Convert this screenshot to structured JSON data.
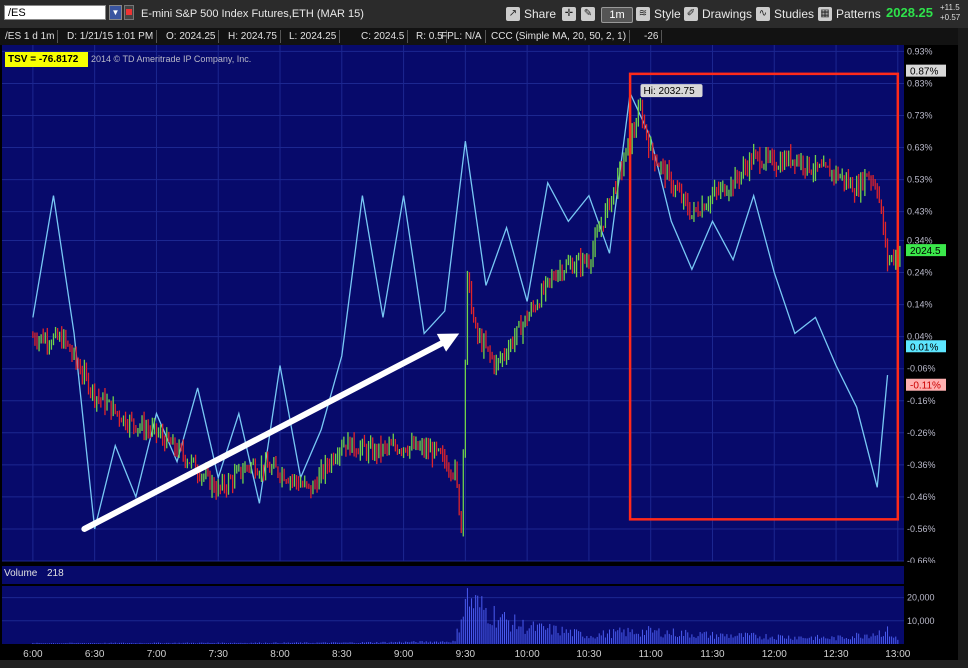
{
  "toolbar": {
    "symbol": "/ES",
    "instrument_title": "E-mini S&P 500 Index Futures,ETH (MAR 15)",
    "share_label": "Share",
    "timeframe_label": "1m",
    "style_label": "Style",
    "drawings_label": "Drawings",
    "studies_label": "Studies",
    "patterns_label": "Patterns",
    "last_price": "2028.25",
    "change_abs": "+11.5",
    "change_pct": "+0.57"
  },
  "info": {
    "chart_label": "/ES 1 d 1m",
    "date": "D: 1/21/15 1:01 PM",
    "open": "O: 2024.25",
    "high": "H: 2024.75",
    "low": "L: 2024.25",
    "close": "C: 2024.5",
    "range": "R: 0.5",
    "fpl": "FPL: N/A",
    "study": "CCC (Simple MA, 20, 50, 2, 1)",
    "study_value": "-26"
  },
  "tsv": {
    "label": "TSV  = -76.8172",
    "copyright": "2014 © TD Ameritrade IP Company, Inc."
  },
  "volume": {
    "label": "Volume",
    "value": "218"
  },
  "colors": {
    "chart_bg": "#070a6b",
    "up_bar": "#6fd24a",
    "down_bar": "#e0242a",
    "oscillator": "#78c8f5",
    "box": "#ff2a1a",
    "arrow": "#ffffff",
    "grid": "#1c2790"
  },
  "chart_data": {
    "type": "line",
    "price_axis_ticks": [
      "0.93%",
      "0.83%",
      "0.73%",
      "0.63%",
      "0.53%",
      "0.43%",
      "0.34%",
      "0.24%",
      "0.14%",
      "0.04%",
      "-0.06%",
      "-0.16%",
      "-0.26%",
      "-0.36%",
      "-0.46%",
      "-0.56%",
      "-0.66%"
    ],
    "time_ticks": [
      "6:00",
      "6:30",
      "7:00",
      "7:30",
      "8:00",
      "8:30",
      "9:00",
      "9:30",
      "10:00",
      "10:30",
      "11:00",
      "11:30",
      "12:00",
      "12:30",
      "13:00"
    ],
    "high_annotation": "Hi: 2032.75",
    "price_labels": [
      {
        "text": "0.87%",
        "value": 0.87
      },
      {
        "text": "2024.5",
        "value": 0.31
      },
      {
        "text": "0.01%",
        "value": 0.01
      },
      {
        "text": "-0.11%",
        "value": -0.11
      }
    ],
    "price_series": {
      "name": "/ES",
      "x": [
        "6:00",
        "6:15",
        "6:30",
        "6:45",
        "7:00",
        "7:15",
        "7:30",
        "7:45",
        "8:00",
        "8:15",
        "8:30",
        "8:45",
        "9:00",
        "9:15",
        "9:25",
        "9:28",
        "9:31",
        "9:35",
        "9:45",
        "10:00",
        "10:15",
        "10:30",
        "10:45",
        "10:55",
        "11:00",
        "11:10",
        "11:20",
        "11:30",
        "11:40",
        "11:50",
        "12:00",
        "12:10",
        "12:20",
        "12:30",
        "12:40",
        "12:45",
        "12:50",
        "12:55",
        "13:01"
      ],
      "values": [
        0.04,
        0.03,
        -0.14,
        -0.22,
        -0.26,
        -0.34,
        -0.44,
        -0.36,
        -0.38,
        -0.44,
        -0.29,
        -0.32,
        -0.3,
        -0.32,
        -0.38,
        -0.55,
        0.22,
        0.05,
        -0.05,
        0.1,
        0.25,
        0.28,
        0.55,
        0.75,
        0.62,
        0.52,
        0.42,
        0.48,
        0.52,
        0.6,
        0.58,
        0.6,
        0.56,
        0.55,
        0.5,
        0.55,
        0.51,
        0.28,
        0.3
      ]
    },
    "oscillator_series": {
      "x": [
        "6:00",
        "6:10",
        "6:20",
        "6:30",
        "6:40",
        "6:50",
        "7:00",
        "7:10",
        "7:20",
        "7:30",
        "7:40",
        "7:50",
        "8:00",
        "8:10",
        "8:20",
        "8:30",
        "8:40",
        "8:50",
        "9:00",
        "9:10",
        "9:20",
        "9:30",
        "9:40",
        "9:50",
        "10:00",
        "10:10",
        "10:20",
        "10:30",
        "10:40",
        "10:50",
        "11:00",
        "11:10",
        "11:20",
        "11:30",
        "11:40",
        "11:50",
        "12:00",
        "12:10",
        "12:20",
        "12:30",
        "12:40",
        "12:50",
        "12:55"
      ],
      "values": [
        0.1,
        0.48,
        0.05,
        -0.56,
        -0.3,
        -0.46,
        -0.2,
        -0.35,
        -0.12,
        -0.4,
        -0.2,
        -0.48,
        -0.05,
        -0.4,
        -0.25,
        -0.02,
        0.48,
        0.1,
        0.48,
        0.05,
        0.12,
        0.65,
        0.2,
        0.38,
        0.15,
        0.52,
        0.4,
        0.48,
        0.3,
        0.8,
        0.66,
        0.4,
        0.25,
        0.4,
        0.28,
        0.48,
        0.24,
        0.05,
        0.1,
        -0.05,
        -0.18,
        -0.43,
        -0.08
      ]
    },
    "volume_ticks": [
      "20,000",
      "10,000"
    ],
    "volume_series": {
      "x": [
        "6:00",
        "8:30",
        "9:00",
        "9:25",
        "9:30",
        "9:40",
        "9:50",
        "10:00",
        "10:15",
        "10:30",
        "10:45",
        "11:00",
        "11:30",
        "12:00",
        "12:30",
        "12:55",
        "13:00"
      ],
      "values": [
        400,
        600,
        900,
        1200,
        22000,
        16000,
        11000,
        8000,
        6500,
        4000,
        5500,
        6000,
        4200,
        3600,
        2800,
        6000,
        2000
      ]
    },
    "box_annotation": {
      "x_start": "10:50",
      "x_end": "13:00",
      "y_top": 0.86,
      "y_bottom": -0.53
    },
    "arrow_annotation": {
      "from": {
        "x": "6:25",
        "y": -0.56
      },
      "to": {
        "x": "9:27",
        "y": 0.05
      }
    },
    "grid": true
  }
}
